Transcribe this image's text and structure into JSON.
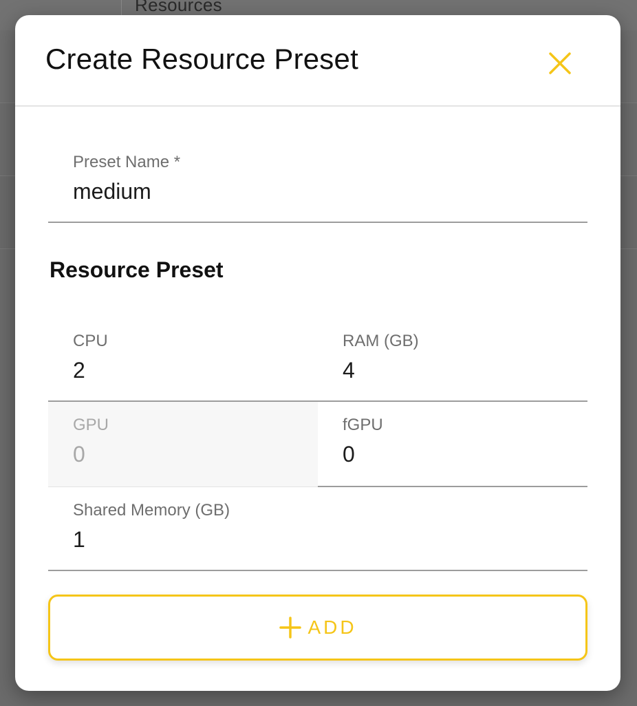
{
  "background": {
    "top_text": "Resources"
  },
  "dialog": {
    "title": "Create Resource Preset",
    "close_icon": "close-icon",
    "accent_color": "#f5c518",
    "preset_name": {
      "label": "Preset Name *",
      "value": "medium"
    },
    "section_heading": "Resource Preset",
    "fields": {
      "cpu": {
        "label": "CPU",
        "value": "2"
      },
      "ram": {
        "label": "RAM (GB)",
        "value": "4"
      },
      "gpu": {
        "label": "GPU",
        "value": "0",
        "disabled": true
      },
      "fgpu": {
        "label": "fGPU",
        "value": "0"
      },
      "shared_memory": {
        "label": "Shared Memory (GB)",
        "value": "1"
      }
    },
    "add_button": {
      "label": "ADD",
      "icon": "plus-icon"
    }
  }
}
